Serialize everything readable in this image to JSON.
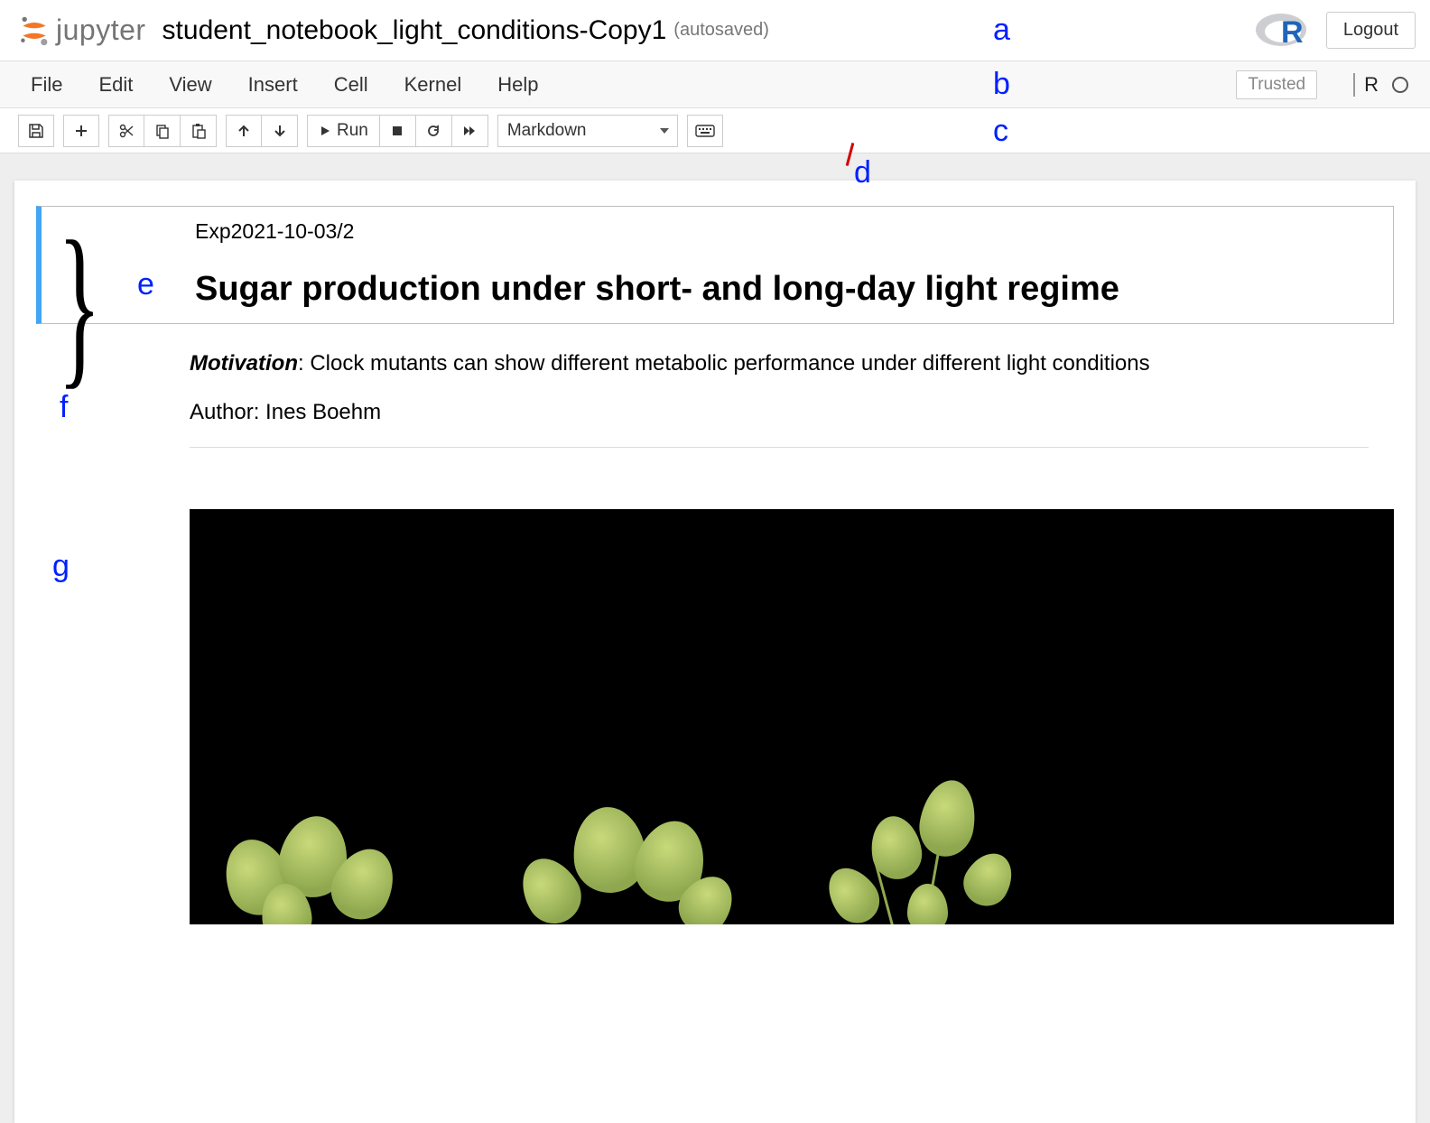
{
  "header": {
    "jupyter_word": "jupyter",
    "notebook_title": "student_notebook_light_conditions-Copy1",
    "autosaved": "(autosaved)",
    "logout": "Logout"
  },
  "menubar": {
    "items": [
      "File",
      "Edit",
      "View",
      "Insert",
      "Cell",
      "Kernel",
      "Help"
    ],
    "trusted": "Trusted",
    "kernel_name": "R"
  },
  "toolbar": {
    "run_label": "Run",
    "cell_type": "Markdown"
  },
  "notebook": {
    "cell1": {
      "exp_id": "Exp2021-10-03/2",
      "title": "Sugar production under short- and long-day light regime"
    },
    "cell2": {
      "motivation_label": "Motivation",
      "motivation_text": ": Clock mutants can show different metabolic performance under different light conditions",
      "author": "Author: Ines Boehm"
    }
  },
  "annotations": {
    "a": "a",
    "b": "b",
    "c": "c",
    "d": "d",
    "e": "e",
    "f": "f",
    "g": "g"
  }
}
